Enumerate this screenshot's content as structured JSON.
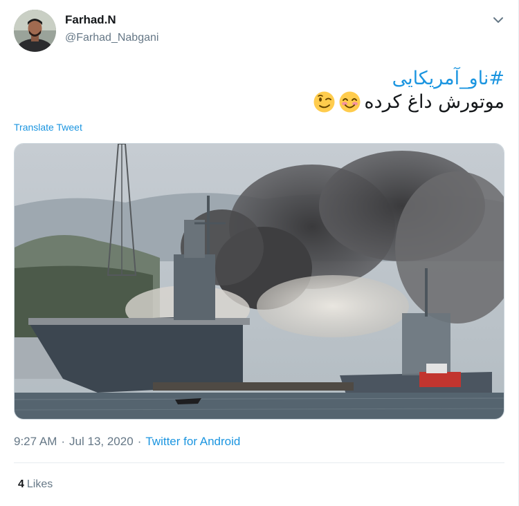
{
  "author": {
    "name": "Farhad.N",
    "handle": "@Farhad_Nabgani"
  },
  "tweet": {
    "hashtag": "#ناو_آمریکایی",
    "text": "موتورش داغ کرده",
    "emojis": [
      "smiling-face-with-smiling-eyes",
      "winking-face"
    ],
    "translate_label": "Translate Tweet"
  },
  "meta": {
    "time": "9:27 AM",
    "separator1": "·",
    "date": "Jul 13, 2020",
    "separator2": "·",
    "source": "Twitter for Android"
  },
  "stats": {
    "likes_count": "4",
    "likes_label": "Likes"
  },
  "colors": {
    "link": "#1b95e0",
    "secondary_text": "#657786",
    "primary_text": "#14171a"
  }
}
